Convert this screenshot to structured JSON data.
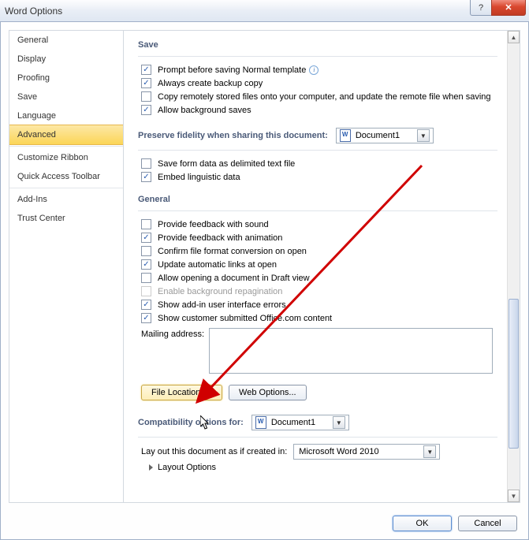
{
  "window": {
    "title": "Word Options"
  },
  "sidebar": {
    "items": [
      {
        "label": "General"
      },
      {
        "label": "Display"
      },
      {
        "label": "Proofing"
      },
      {
        "label": "Save"
      },
      {
        "label": "Language"
      },
      {
        "label": "Advanced"
      },
      {
        "label": "Customize Ribbon"
      },
      {
        "label": "Quick Access Toolbar"
      },
      {
        "label": "Add-Ins"
      },
      {
        "label": "Trust Center"
      }
    ],
    "selected_index": 5
  },
  "sections": {
    "save": {
      "heading": "Save",
      "options": [
        {
          "checked": true,
          "label": "Prompt before saving Normal template",
          "info": true
        },
        {
          "checked": true,
          "label": "Always create backup copy"
        },
        {
          "checked": false,
          "label": "Copy remotely stored files onto your computer, and update the remote file when saving"
        },
        {
          "checked": true,
          "label": "Allow background saves"
        }
      ]
    },
    "preserve": {
      "heading": "Preserve fidelity when sharing this document:",
      "document": "Document1",
      "options": [
        {
          "checked": false,
          "label": "Save form data as delimited text file"
        },
        {
          "checked": true,
          "label": "Embed linguistic data"
        }
      ]
    },
    "general": {
      "heading": "General",
      "options": [
        {
          "checked": false,
          "label": "Provide feedback with sound"
        },
        {
          "checked": true,
          "label": "Provide feedback with animation"
        },
        {
          "checked": false,
          "label": "Confirm file format conversion on open"
        },
        {
          "checked": true,
          "label": "Update automatic links at open"
        },
        {
          "checked": false,
          "label": "Allow opening a document in Draft view"
        },
        {
          "checked": false,
          "label": "Enable background repagination",
          "disabled": true
        },
        {
          "checked": true,
          "label": "Show add-in user interface errors"
        },
        {
          "checked": true,
          "label": "Show customer submitted Office.com content"
        }
      ],
      "mailing_label": "Mailing address:",
      "mailing_value": "",
      "buttons": {
        "file_locations": "File Locations...",
        "web_options": "Web Options..."
      }
    },
    "compat": {
      "heading": "Compatibility options for:",
      "document": "Document1",
      "layout_label": "Lay out this document as if created in:",
      "layout_value": "Microsoft Word 2010",
      "layout_options": "Layout Options"
    }
  },
  "footer": {
    "ok": "OK",
    "cancel": "Cancel"
  }
}
